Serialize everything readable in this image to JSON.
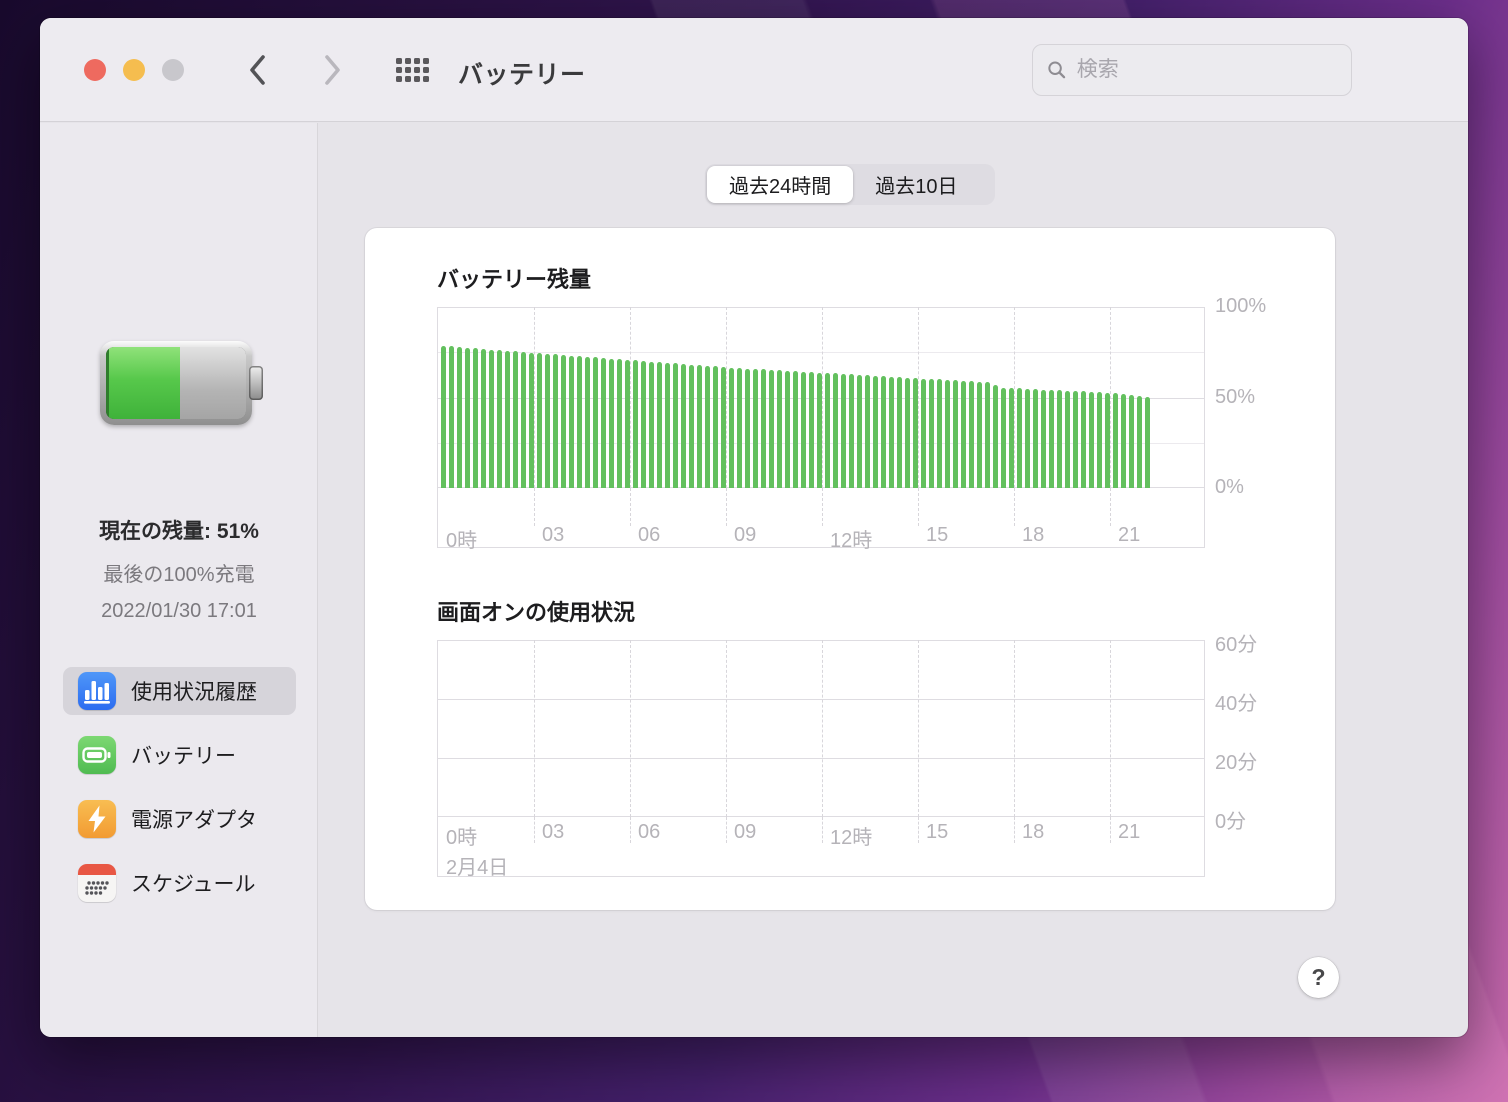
{
  "window": {
    "title": "バッテリー",
    "search_placeholder": "検索"
  },
  "sidebar": {
    "status": {
      "current": "現在の残量: 51%",
      "last_full": "最後の100%充電",
      "last_full_date": "2022/01/30 17:01"
    },
    "items": [
      {
        "label": "使用状況履歴",
        "icon": "usage-history-icon",
        "selected": true
      },
      {
        "label": "バッテリー",
        "icon": "battery-icon",
        "selected": false
      },
      {
        "label": "電源アダプタ",
        "icon": "power-adapter-icon",
        "selected": false
      },
      {
        "label": "スケジュール",
        "icon": "schedule-icon",
        "selected": false
      }
    ]
  },
  "tabs": [
    {
      "label": "過去24時間",
      "selected": true
    },
    {
      "label": "過去10日",
      "selected": false
    }
  ],
  "help": {
    "label": "?"
  },
  "icons": {
    "toolbar": [
      "close-icon",
      "minimize-icon",
      "zoom-icon",
      "chevron-left-icon",
      "chevron-right-icon",
      "app-grid-icon",
      "search-icon"
    ]
  },
  "colors": {
    "bar_green": "#63c05e",
    "traffic_close": "#ee6a5f",
    "traffic_minimize": "#f5bd4f",
    "traffic_zoom_disabled": "#c8c7cc",
    "icon_blue": "#3478f6",
    "icon_green": "#65c466",
    "icon_orange": "#f5a33b"
  },
  "chart_data": [
    {
      "type": "bar",
      "title": "バッテリー残量",
      "unit": "%",
      "ylim": [
        0,
        100
      ],
      "gridlines_y": [
        100,
        75,
        50,
        25,
        0
      ],
      "y_ticks": [
        {
          "value": 100,
          "label": "100%"
        },
        {
          "value": 50,
          "label": "50%"
        },
        {
          "value": 0,
          "label": "0%"
        }
      ],
      "x_range_hours": [
        0,
        24
      ],
      "x_tick_hours": [
        0,
        3,
        6,
        9,
        12,
        15,
        18,
        21
      ],
      "x_tick_labels": [
        "0時",
        "03",
        "06",
        "09",
        "12時",
        "15",
        "18",
        "21"
      ],
      "bar_interval_minutes": 15,
      "bar_color": "#63c05e",
      "grid": true,
      "values": [
        78.5,
        78.2,
        77.8,
        77.5,
        77.2,
        76.8,
        76.5,
        76.2,
        75.8,
        75.5,
        75.2,
        74.8,
        74.5,
        74.2,
        73.8,
        73.5,
        73.2,
        72.8,
        72.5,
        72.2,
        71.8,
        71.5,
        71.2,
        70.8,
        70.5,
        70.2,
        69.8,
        69.5,
        69.2,
        68.8,
        68.5,
        68.2,
        67.8,
        67.5,
        67.2,
        66.8,
        66.5,
        66.3,
        66.0,
        65.8,
        65.5,
        65.3,
        65.0,
        64.8,
        64.5,
        64.3,
        64.0,
        63.8,
        63.5,
        63.3,
        63.0,
        62.8,
        62.5,
        62.3,
        62.0,
        61.8,
        61.5,
        61.3,
        61.0,
        60.8,
        60.5,
        60.3,
        60.0,
        59.8,
        59.5,
        59.3,
        59.0,
        58.8,
        58.5,
        57.0,
        55.5,
        55.3,
        55.1,
        54.9,
        54.6,
        54.4,
        54.2,
        54.0,
        53.8,
        53.6,
        53.4,
        53.1,
        52.9,
        52.7,
        52.5,
        52.0,
        51.5,
        51.0,
        50.5
      ]
    },
    {
      "type": "bar",
      "title": "画面オンの使用状況",
      "unit": "分",
      "ylim": [
        0,
        60
      ],
      "gridlines_y": [
        60,
        40,
        20,
        0
      ],
      "y_ticks": [
        {
          "value": 60,
          "label": "60分"
        },
        {
          "value": 40,
          "label": "40分"
        },
        {
          "value": 20,
          "label": "20分"
        },
        {
          "value": 0,
          "label": "0分"
        }
      ],
      "x_range_hours": [
        0,
        24
      ],
      "x_tick_hours": [
        0,
        3,
        6,
        9,
        12,
        15,
        18,
        21
      ],
      "x_tick_labels": [
        "0時",
        "03",
        "06",
        "09",
        "12時",
        "15",
        "18",
        "21"
      ],
      "date_label": "2月4日",
      "bar_color": "#63c05e",
      "grid": true,
      "values": []
    }
  ]
}
